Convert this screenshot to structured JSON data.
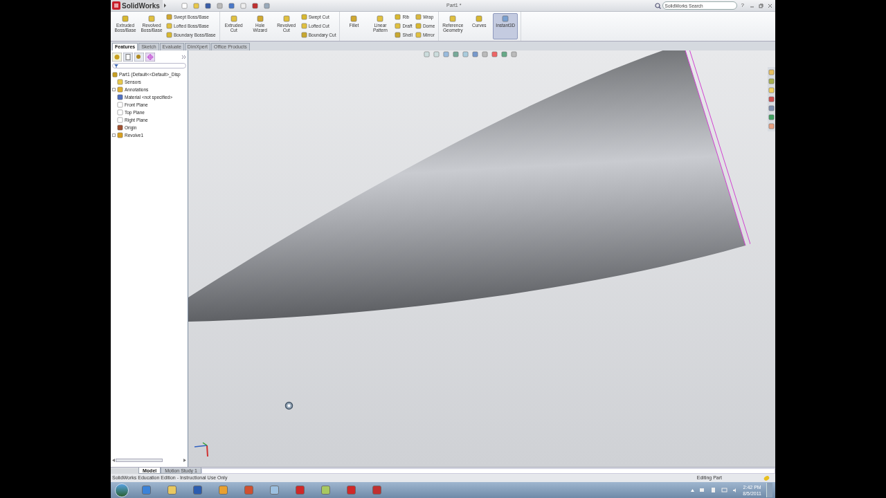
{
  "app": {
    "logo": "SolidWorks",
    "document_title": "Part1 *",
    "search": {
      "placeholder": "SolidWorks Search"
    },
    "help": "?"
  },
  "ribbon": {
    "groups": [
      {
        "items": [
          {
            "kind": "large",
            "label": "Extruded Boss/Base",
            "on": false
          },
          {
            "kind": "large",
            "label": "Revolved Boss/Base",
            "on": false
          },
          {
            "kind": "small",
            "label": "Swept Boss/Base",
            "on": false
          },
          {
            "kind": "small",
            "label": "Lofted Boss/Base",
            "on": false
          },
          {
            "kind": "small",
            "label": "Boundary Boss/Base",
            "on": false
          }
        ]
      },
      {
        "items": [
          {
            "kind": "large",
            "label": "Extruded Cut",
            "on": false
          },
          {
            "kind": "large",
            "label": "Hole Wizard",
            "on": false
          },
          {
            "kind": "large",
            "label": "Revolved Cut",
            "on": false
          },
          {
            "kind": "small",
            "label": "Swept Cut",
            "on": false
          },
          {
            "kind": "small",
            "label": "Lofted Cut",
            "on": false
          },
          {
            "kind": "small",
            "label": "Boundary Cut",
            "on": false
          }
        ]
      },
      {
        "items": [
          {
            "kind": "large",
            "label": "Fillet",
            "on": false
          },
          {
            "kind": "large",
            "label": "Linear Pattern",
            "on": false
          },
          {
            "kind": "small",
            "label": "Rib",
            "on": false
          },
          {
            "kind": "small",
            "label": "Draft",
            "on": false
          },
          {
            "kind": "small",
            "label": "Shell",
            "on": false
          },
          {
            "kind": "small",
            "label": "Wrap",
            "on": false
          },
          {
            "kind": "small",
            "label": "Dome",
            "on": false
          },
          {
            "kind": "small",
            "label": "Mirror",
            "on": false
          }
        ]
      },
      {
        "items": [
          {
            "kind": "large",
            "label": "Reference Geometry",
            "on": false
          },
          {
            "kind": "large",
            "label": "Curves",
            "on": false
          },
          {
            "kind": "large",
            "label": "Instant3D",
            "on": true
          }
        ]
      }
    ]
  },
  "command_tabs": [
    {
      "label": "Features",
      "selected": true
    },
    {
      "label": "Sketch",
      "selected": false
    },
    {
      "label": "Evaluate",
      "selected": false
    },
    {
      "label": "DimXpert",
      "selected": false
    },
    {
      "label": "Office Products",
      "selected": false
    }
  ],
  "feature_tree": {
    "root": {
      "label": "Part1  (Default<<Default>_Disp",
      "children": [
        {
          "label": "Sensors",
          "expandable": false
        },
        {
          "label": "Annotations",
          "expandable": true
        },
        {
          "label": "Material <not specified>",
          "expandable": false
        },
        {
          "label": "Front Plane",
          "expandable": false
        },
        {
          "label": "Top Plane",
          "expandable": false
        },
        {
          "label": "Right Plane",
          "expandable": false
        },
        {
          "label": "Origin",
          "expandable": false
        },
        {
          "label": "Revolve1",
          "expandable": true
        }
      ]
    }
  },
  "bottom_tabs": [
    {
      "label": "Model",
      "selected": true
    },
    {
      "label": "Motion Study 1",
      "selected": false
    }
  ],
  "status_bar": {
    "message": "SolidWorks Education Edition - Instructional Use Only",
    "mode": "Editing Part"
  },
  "taskbar": {
    "time": "2:42 PM",
    "date": "8/5/2011"
  }
}
